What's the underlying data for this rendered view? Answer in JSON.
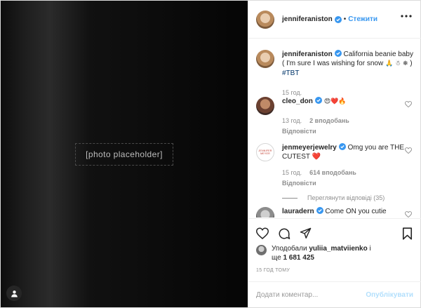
{
  "photo": {
    "placeholder_label": "[photo placeholder]"
  },
  "header": {
    "username": "jenniferaniston",
    "separator": "•",
    "follow_label": "Стежити"
  },
  "caption": {
    "username": "jenniferaniston",
    "text": "California beanie baby ( I'm sure I was wishing for snow",
    "emojis": "🙏 ☃ ❄",
    "close": ")",
    "hashtag": "#TBT",
    "time": "15 год."
  },
  "comments": [
    {
      "username": "cleo_don",
      "text": "😍❤️🔥",
      "time": "13 год.",
      "likes": "2 вподобань",
      "reply_label": "Відповісти"
    },
    {
      "username": "jenmeyerjewelry",
      "avatar_text": "JENNIFER MEYER",
      "text": "Omg you are THE CUTEST ❤️",
      "time": "15 год.",
      "likes": "614 вподобань",
      "reply_label": "Відповісти",
      "view_replies": "Переглянути відповіді (35)"
    },
    {
      "username": "lauradern",
      "text": "Come ON you cutie"
    }
  ],
  "likes": {
    "prefix": "Уподобали",
    "user": "yuliia_matviienko",
    "middle": "і",
    "more_prefix": "ще",
    "count": "1 681 425"
  },
  "time_ago": "15 ГОД ТОМУ",
  "add_comment": {
    "placeholder": "Додати коментар...",
    "publish_label": "Опублікувати"
  },
  "colors": {
    "accent": "#3897f0",
    "publish_disabled": "#b2dffc",
    "muted": "#8e8e8e",
    "heart_red": "#ed4956"
  }
}
